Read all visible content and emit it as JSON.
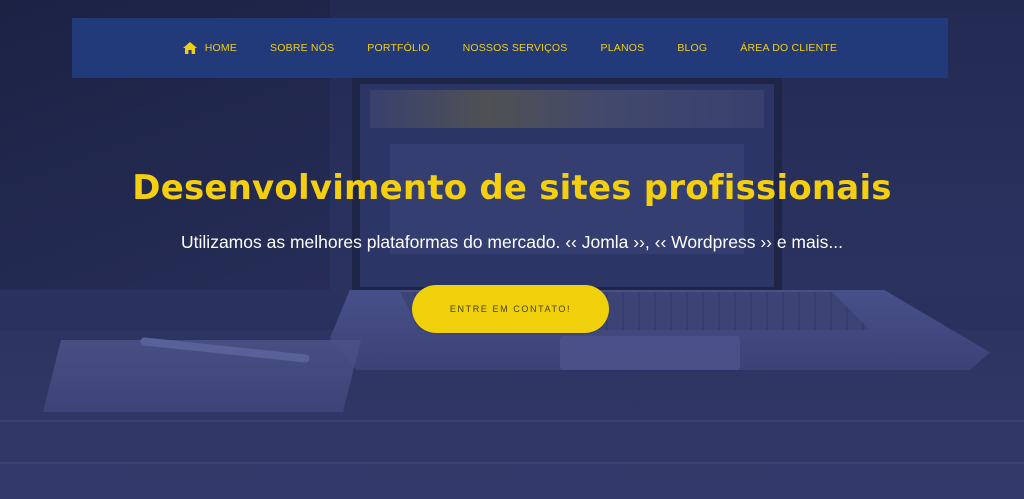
{
  "colors": {
    "nav_background": "#223a7a",
    "accent_yellow": "#f4cf10",
    "hero_overlay": "#262d55",
    "subtitle_text": "#ffffff"
  },
  "nav": {
    "items": [
      {
        "label": "HOME",
        "icon": "home-icon"
      },
      {
        "label": "SOBRE NÓS"
      },
      {
        "label": "PORTFÓLIO"
      },
      {
        "label": "NOSSOS SERVIÇOS"
      },
      {
        "label": "PLANOS"
      },
      {
        "label": "BLOG"
      },
      {
        "label": "ÁREA DO CLIENTE"
      }
    ]
  },
  "hero": {
    "title": "Desenvolvimento de sites profissionais",
    "subtitle": "Utilizamos as melhores plataformas do mercado. ‹‹ Jomla ››, ‹‹ Wordpress ›› e mais...",
    "cta_label": "ENTRE EM CONTATO!"
  }
}
